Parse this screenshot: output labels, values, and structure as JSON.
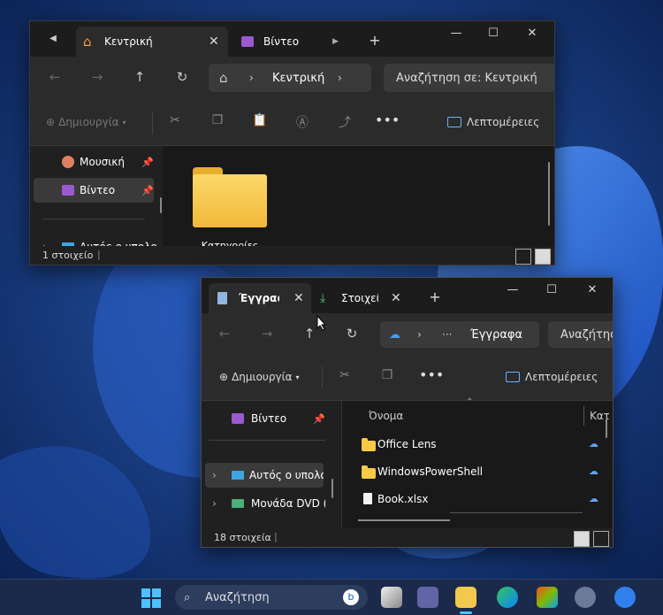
{
  "window_back": {
    "tabs": [
      {
        "label": "Κεντρική",
        "icon": "home-icon",
        "active": true
      },
      {
        "label": "Βίντεο",
        "icon": "video-icon",
        "active": false
      }
    ],
    "new_tab": "+",
    "address": {
      "crumb": "Κεντρική"
    },
    "search_placeholder": "Αναζήτηση σε: Κεντρική",
    "toolbar": {
      "new_label": "Δημιουργία",
      "details_label": "Λεπτομέρειες"
    },
    "sidebar": [
      {
        "label": "Μουσική",
        "icon": "music-icon",
        "pinned": true
      },
      {
        "label": "Βίντεο",
        "icon": "video-icon",
        "pinned": true,
        "selected": true
      },
      {
        "label": "Αυτός ο υπολογιστής",
        "icon": "pc-icon"
      }
    ],
    "content": [
      {
        "label": "Κατηγορίες",
        "icon": "folder-icon"
      }
    ],
    "status": "1 στοιχείο"
  },
  "window_front": {
    "tabs": [
      {
        "label": "Έγγραφα",
        "icon": "document-icon",
        "active": true
      },
      {
        "label": "Στοιχεία λήψης",
        "icon": "download-icon",
        "active": false
      }
    ],
    "new_tab": "+",
    "address": {
      "more": "···",
      "crumb": "Έγγραφα"
    },
    "search_placeholder": "Αναζήτηση σε: Έγγραφα",
    "toolbar": {
      "new_label": "Δημιουργία",
      "details_label": "Λεπτομέρειες"
    },
    "sidebar": [
      {
        "label": "Βίντεο",
        "icon": "video-icon",
        "pinned": true
      },
      {
        "label": "Αυτός ο υπολογιστής",
        "icon": "pc-icon",
        "selected": true
      },
      {
        "label": "Μονάδα DVD (D:)",
        "icon": "dvd-icon"
      }
    ],
    "columns": {
      "name": "Όνομα",
      "status": "Κατάσταση"
    },
    "files": [
      {
        "name": "Office Lens",
        "type": "folder",
        "cloud": true
      },
      {
        "name": "WindowsPowerShell",
        "type": "folder",
        "cloud": true
      },
      {
        "name": "Book.xlsx",
        "type": "file",
        "cloud": true
      }
    ],
    "status": "18 στοιχεία"
  },
  "taskbar": {
    "search_placeholder": "Αναζήτηση",
    "apps": [
      "start-icon",
      "search-icon",
      "task-view-icon",
      "teams-icon",
      "file-explorer-icon",
      "edge-icon",
      "store-icon",
      "settings-icon",
      "snipping-tool-icon"
    ]
  },
  "colors": {
    "accent": "#4cc2ff",
    "folder": "#f7c948",
    "window_bg": "#202020",
    "toolbar_bg": "#2b2b2b"
  }
}
